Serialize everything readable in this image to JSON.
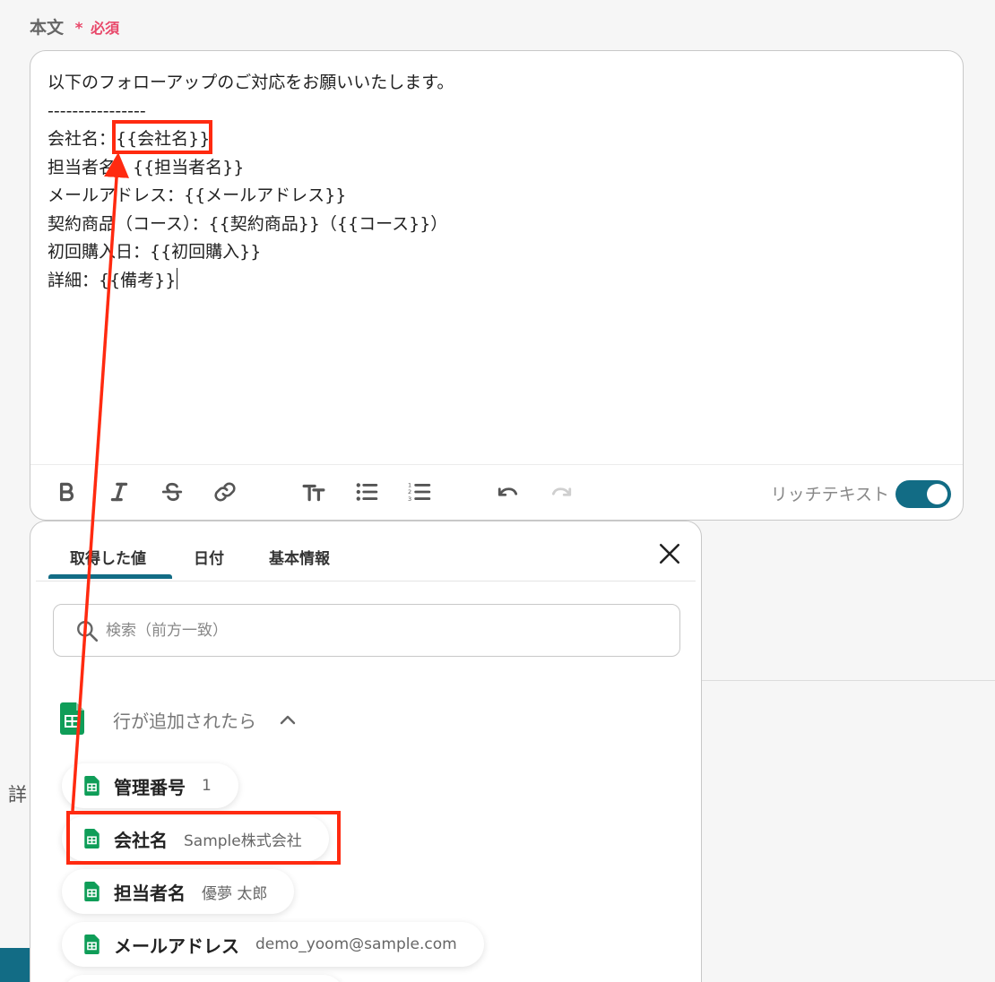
{
  "field": {
    "label": "本文",
    "required_mark": "*",
    "required_text": "必須"
  },
  "editor": {
    "lines": [
      "以下のフォローアップのご対応をお願いいたします。",
      "----------------",
      "会社名：{{会社名}}",
      "担当者名：{{担当者名}}",
      "メールアドレス：{{メールアドレス}}",
      "契約商品（コース）：{{契約商品}}（{{コース}}）",
      "初回購入日：{{初回購入}}",
      "詳細：{{備考}}"
    ],
    "toolbar_icons": [
      "bold-icon",
      "italic-icon",
      "strikethrough-icon",
      "link-icon",
      "text-size-icon",
      "bullet-list-icon",
      "numbered-list-icon",
      "undo-icon",
      "redo-icon"
    ],
    "rich_text_label": "リッチテキスト",
    "rich_text_on": true
  },
  "background": {
    "partial_label": "詳"
  },
  "panel": {
    "tabs": [
      {
        "label": "取得した値",
        "active": true
      },
      {
        "label": "日付",
        "active": false
      },
      {
        "label": "基本情報",
        "active": false
      }
    ],
    "search_placeholder": "検索（前方一致）",
    "group": {
      "label": "行が追加されたら",
      "icon": "google-sheets-icon",
      "expanded": true
    },
    "items": [
      {
        "name": "管理番号",
        "value": "1",
        "highlighted": false
      },
      {
        "name": "会社名",
        "value": "Sample株式会社",
        "highlighted": true
      },
      {
        "name": "担当者名",
        "value": "優夢 太郎",
        "highlighted": false
      },
      {
        "name": "メールアドレス",
        "value": "demo_yoom@sample.com",
        "highlighted": false
      },
      {
        "name": "",
        "value": "",
        "highlighted": false
      }
    ]
  },
  "colors": {
    "accent": "#126c85",
    "highlight": "#ff2a10",
    "required": "#e8486a",
    "sheets_green": "#0f9d58"
  }
}
